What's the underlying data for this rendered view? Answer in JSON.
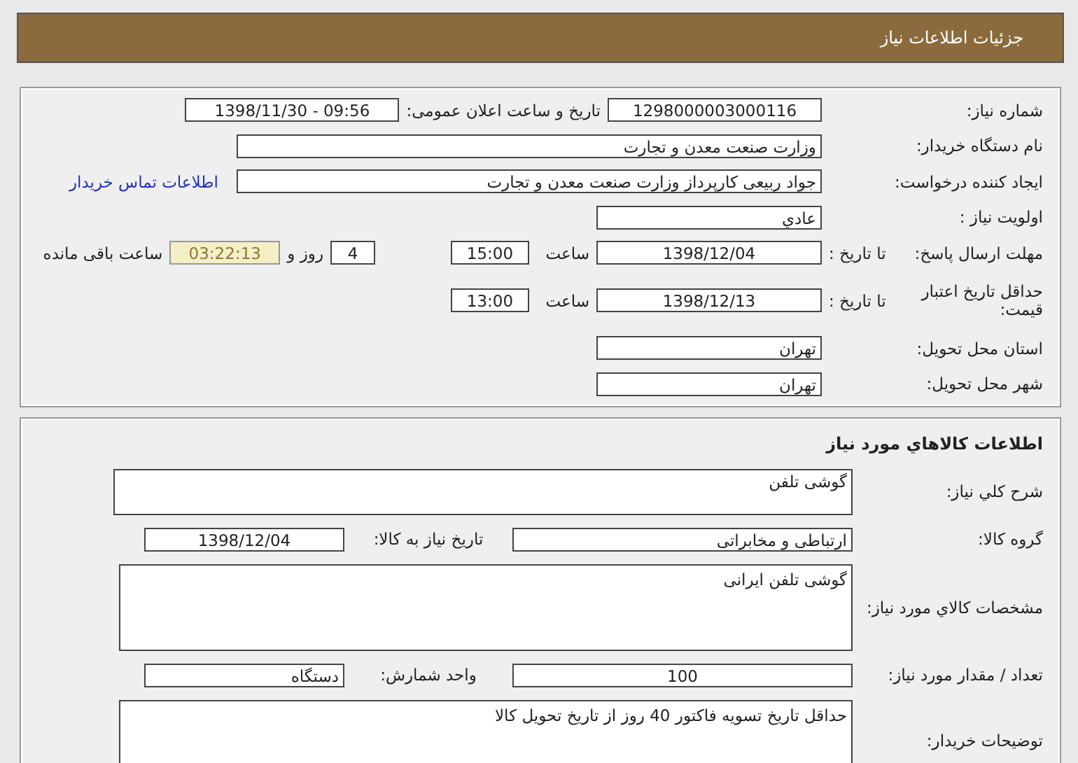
{
  "header": {
    "title": "جزئیات اطلاعات نیاز"
  },
  "details": {
    "rows": [
      {
        "kind": "dual",
        "label": "شماره نیاز:",
        "value": "1298000003000116",
        "label2": "تاریخ و ساعت اعلان عمومی:",
        "value2": "1398/11/30 - 09:56"
      },
      {
        "kind": "wide",
        "label": "نام دستگاه خریدار:",
        "value": "وزارت صنعت معدن و تجارت"
      },
      {
        "kind": "wide",
        "label": "ایجاد کننده درخواست:",
        "value": "جواد ربیعی کارپرداز وزارت صنعت معدن و تجارت",
        "link": "اطلاعات تماس خریدار"
      },
      {
        "kind": "short",
        "label": "اولویت نیاز :",
        "value": "عادي"
      },
      {
        "kind": "deadline",
        "label": "مهلت ارسال پاسخ:",
        "sublabel": "تا تاریخ :",
        "value": "1398/12/04",
        "time_label": "ساعت",
        "time": "15:00",
        "days": "4",
        "days_label": "روز و",
        "remaining": "03:22:13",
        "remaining_label": "ساعت باقی مانده"
      },
      {
        "kind": "deadline",
        "label": "حداقل تاریخ اعتبار قیمت:",
        "sublabel": "تا تاریخ :",
        "value": "1398/12/13",
        "time_label": "ساعت",
        "time": "13:00"
      },
      {
        "kind": "short",
        "label": "استان محل تحویل:",
        "value": "تهران"
      },
      {
        "kind": "short",
        "label": "شهر محل تحویل:",
        "value": "تهران"
      }
    ]
  },
  "goods": {
    "title": "اطلاعات کالاهاي مورد نياز",
    "rows": [
      {
        "kind": "box",
        "label": "شرح کلي نياز:",
        "value": "گوشی تلفن"
      },
      {
        "kind": "dual",
        "label": "گروه کالا:",
        "value": "ارتباطی و مخابراتی",
        "label2": "تاریخ نیاز به کالا:",
        "value2": "1398/12/04"
      },
      {
        "kind": "area",
        "label": "مشخصات کالاي مورد نياز:",
        "value": "گوشی تلفن ایرانی"
      },
      {
        "kind": "dual",
        "label": "تعداد / مقدار مورد نیاز:",
        "value": "100",
        "label2": "واحد شمارش:",
        "value2": "دستگاه"
      },
      {
        "kind": "area",
        "label": "توضیحات خریدار:",
        "value": "حداقل تاریخ تسویه فاکتور 40 روز از تاریخ تحویل کالا"
      }
    ]
  }
}
